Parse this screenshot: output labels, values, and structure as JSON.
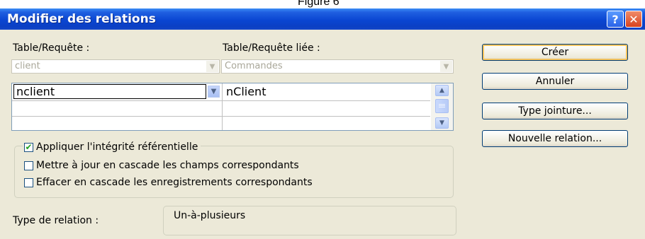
{
  "caption": "Figure 6",
  "window": {
    "title": "Modifier des relations",
    "help_label": "?",
    "close_label": "✕"
  },
  "left_table": {
    "label": "Table/Requête :",
    "value": "client"
  },
  "right_table": {
    "label": "Table/Requête liée :",
    "value": "Commandes"
  },
  "fields_grid": {
    "rows": [
      {
        "left": "nclient",
        "right": "nClient"
      }
    ]
  },
  "options": {
    "enforce_integrity": {
      "label": "Appliquer l'intégrité référentielle",
      "checked": true
    },
    "cascade_update": {
      "label": "Mettre à jour en cascade les champs correspondants",
      "checked": false
    },
    "cascade_delete": {
      "label": "Effacer en cascade les enregistrements correspondants",
      "checked": false
    }
  },
  "relation_type": {
    "label": "Type de relation :",
    "value": "Un-à-plusieurs"
  },
  "buttons": {
    "create": "Créer",
    "cancel": "Annuler",
    "join_type": "Type jointure...",
    "new_relation": "Nouvelle relation..."
  },
  "icons": {
    "dropdown": "chevron-down-icon",
    "scroll_up": "scroll-up-icon",
    "scroll_down": "scroll-down-icon",
    "check": "checkmark-icon"
  },
  "colors": {
    "titlebar": "#0a46d2",
    "dialog_bg": "#ece9d8",
    "check_mark": "#21a121",
    "button_border": "#003c74"
  }
}
